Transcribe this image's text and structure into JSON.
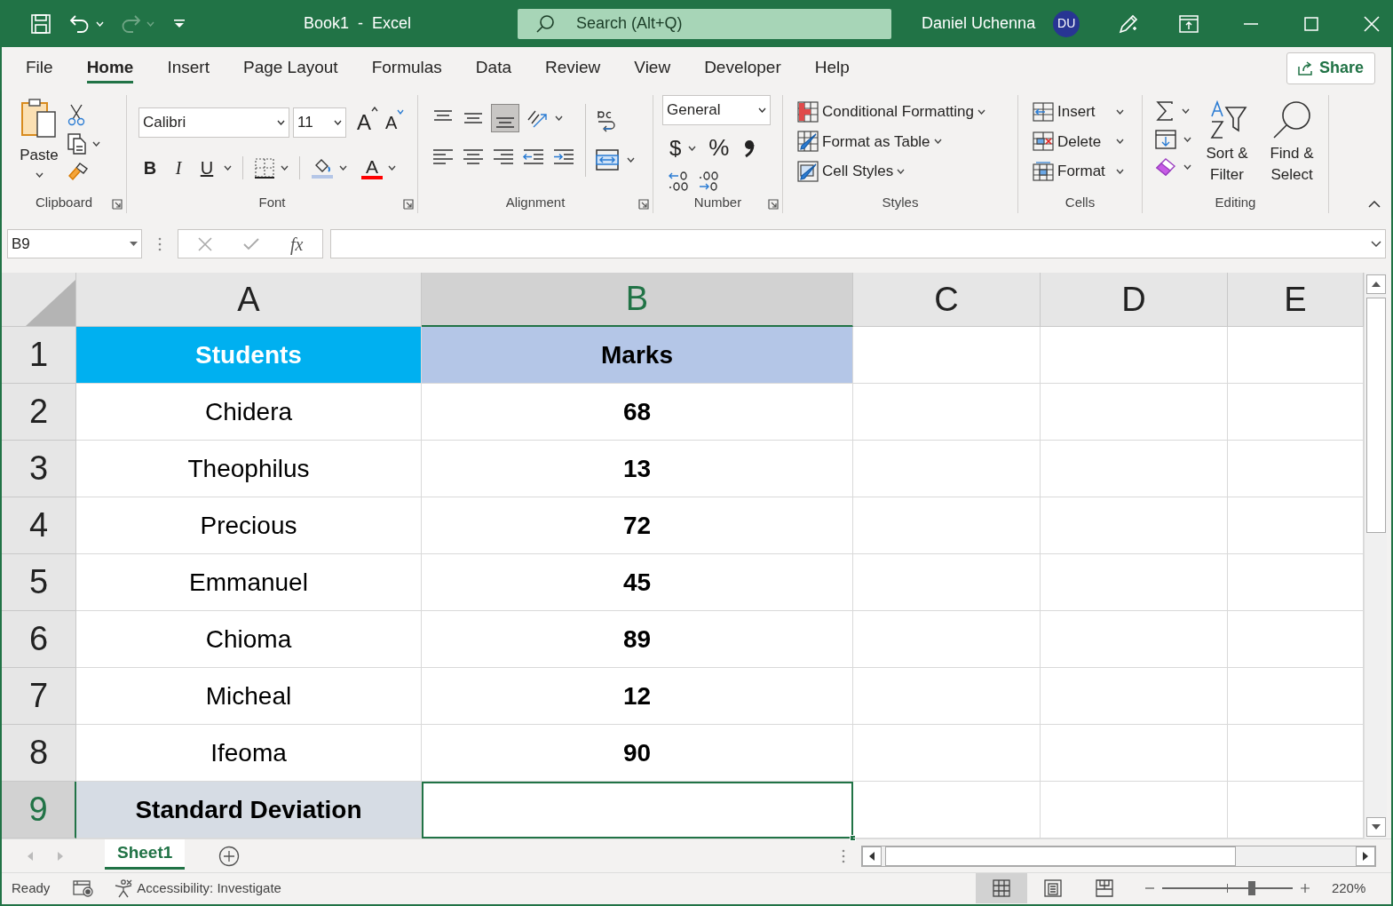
{
  "title_bar": {
    "title": "Book1  -  Excel",
    "search": {
      "placeholder": "Search (Alt+Q)"
    },
    "user_name": "Daniel Uchenna",
    "avatar": "DU"
  },
  "ribbon_tabs": [
    {
      "label": "File",
      "selected": false
    },
    {
      "label": "Home",
      "selected": true
    },
    {
      "label": "Insert",
      "selected": false
    },
    {
      "label": "Page Layout",
      "selected": false
    },
    {
      "label": "Formulas",
      "selected": false
    },
    {
      "label": "Data",
      "selected": false
    },
    {
      "label": "Review",
      "selected": false
    },
    {
      "label": "View",
      "selected": false
    },
    {
      "label": "Developer",
      "selected": false
    },
    {
      "label": "Help",
      "selected": false
    }
  ],
  "share_button": "Share",
  "ribbon": {
    "clipboard": {
      "paste": "Paste",
      "label": "Clipboard"
    },
    "font": {
      "font_name": "Calibri",
      "font_size": "11",
      "grow": "A",
      "shrink": "A",
      "bold": "B",
      "italic": "I",
      "underline": "U",
      "font_color": "A",
      "label": "Font"
    },
    "alignment": {
      "label": "Alignment"
    },
    "number": {
      "format": "General",
      "currency": "$",
      "percent": "%",
      "label": "Number"
    },
    "styles": {
      "items": [
        "Conditional Formatting",
        "Format as Table",
        "Cell Styles"
      ],
      "label": "Styles"
    },
    "cells": {
      "items": [
        "Insert",
        "Delete",
        "Format"
      ],
      "label": "Cells"
    },
    "editing": {
      "sort": "Sort & Filter",
      "find": "Find & Select",
      "label": "Editing"
    }
  },
  "formula_bar": {
    "name_box": "B9",
    "fx": "fx"
  },
  "sheet": {
    "columns": [
      {
        "label": "A",
        "selected": false
      },
      {
        "label": "B",
        "selected": true
      },
      {
        "label": "C",
        "selected": false
      },
      {
        "label": "D",
        "selected": false
      },
      {
        "label": "E",
        "selected": false
      }
    ],
    "rows": [
      {
        "label": "1",
        "selected": false,
        "cells": [
          {
            "text": "Students",
            "bold": true,
            "color": "#00b0f0",
            "active": false
          },
          {
            "text": "Marks",
            "bold": true,
            "color": "#b4c6e7",
            "active": false
          }
        ]
      },
      {
        "label": "2",
        "selected": false,
        "cells": [
          {
            "text": "Chidera",
            "bold": false,
            "active": false
          },
          {
            "text": "68",
            "bold": true,
            "active": false
          }
        ]
      },
      {
        "label": "3",
        "selected": false,
        "cells": [
          {
            "text": "Theophilus",
            "bold": false,
            "active": false
          },
          {
            "text": "13",
            "bold": true,
            "active": false
          }
        ]
      },
      {
        "label": "4",
        "selected": false,
        "cells": [
          {
            "text": "Precious",
            "bold": false,
            "active": false
          },
          {
            "text": "72",
            "bold": true,
            "active": false
          }
        ]
      },
      {
        "label": "5",
        "selected": false,
        "cells": [
          {
            "text": "Emmanuel",
            "bold": false,
            "active": false
          },
          {
            "text": "45",
            "bold": true,
            "active": false
          }
        ]
      },
      {
        "label": "6",
        "selected": false,
        "cells": [
          {
            "text": "Chioma",
            "bold": false,
            "active": false
          },
          {
            "text": "89",
            "bold": true,
            "active": false
          }
        ]
      },
      {
        "label": "7",
        "selected": false,
        "cells": [
          {
            "text": "Micheal",
            "bold": false,
            "active": false
          },
          {
            "text": "12",
            "bold": true,
            "active": false
          }
        ]
      },
      {
        "label": "8",
        "selected": false,
        "cells": [
          {
            "text": "Ifeoma",
            "bold": false,
            "active": false
          },
          {
            "text": "90",
            "bold": true,
            "active": false
          }
        ]
      },
      {
        "label": "9",
        "selected": true,
        "cells": [
          {
            "text": "Standard Deviation",
            "bold": true,
            "color": "#d6dce4",
            "active": false
          },
          {
            "active": true
          }
        ]
      }
    ]
  },
  "sheet_tabs": [
    {
      "label": "Sheet1",
      "selected": true
    }
  ],
  "status_bar": {
    "status": "Ready",
    "accessibility": "Accessibility: Investigate",
    "views": [
      {
        "kind": "normal",
        "selected": true
      },
      {
        "kind": "page_layout",
        "selected": false
      },
      {
        "kind": "page_break",
        "selected": false
      }
    ],
    "zoom": {
      "level": 0.69,
      "reading": "220%"
    }
  }
}
